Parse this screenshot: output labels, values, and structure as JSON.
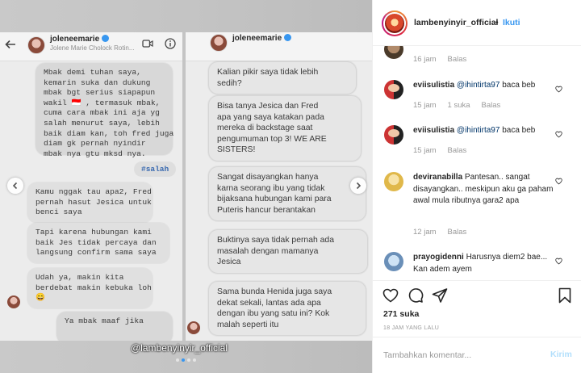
{
  "post": {
    "left_panel": {
      "username": "joleneemarie",
      "fullname": "Jolene Marie Cholock Rotin...",
      "bubbles": [
        "Mbak demi tuhan saya,\nkemarin suka dan dukung\nmbak bgt serius siapapun\nwakil 🇮🇩 , termasuk mbak,\ncuma cara mbak ini aja yg\nsalah menurut saya, lebih\nbaik diam kan, toh fred juga\ndiam gk pernah nyindir\nmbak nya gtu mksd nya.",
        "Kamu nggak tau apa2, Fred\npernah hasut Jesica untuk\nbenci saya",
        "Tapi karena hubungan kami\nbaik Jes tidak percaya dan\nlangsung confirm sama saya",
        "Udah ya, makin kita\nberdebat makin kebuka loh\n😄",
        "Ya mbak maaf jika"
      ],
      "tag": "#salah"
    },
    "right_panel": {
      "username": "joleneemarie",
      "bubbles": [
        "Kalian pikir saya tidak lebih\nsedih?",
        "Bisa tanya Jesica dan Fred\napa yang saya katakan pada\nmereka di backstage saat\npengumuman top 3! WE ARE\nSISTERS!",
        "Sangat disayangkan hanya\nkarna seorang ibu yang tidak\nbijaksana hubungan kami para\nPuteris hancur berantakan",
        "Buktinya saya tidak pernah ada\nmasalah dengan mamanya\nJesica",
        "Sama bunda Henida juga saya\ndekat sekali, lantas ada apa\ndengan ibu yang satu ini? Kok\nmalah seperti itu"
      ]
    },
    "watermark": "@lambenyinyir_official"
  },
  "sidebar": {
    "username": "lambenyinyir_official",
    "separator": "•",
    "follow_label": "Ikuti",
    "comments": [
      {
        "user": "",
        "mention": "",
        "text": "",
        "time": "16 jam",
        "likes": "",
        "reply": "Balas"
      },
      {
        "user": "eviisulistia",
        "mention": "@ihintirta97",
        "text": " baca beb",
        "time": "15 jam",
        "likes": "1 suka",
        "reply": "Balas"
      },
      {
        "user": "eviisulistia",
        "mention": "@ihintirta97",
        "text": " baca beb",
        "time": "15 jam",
        "likes": "",
        "reply": "Balas"
      },
      {
        "user": "deviranabilla",
        "mention": "",
        "text": " Pantesan.. sangat disayangkan.. meskipun aku ga paham awal mula ributnya gara2 apa",
        "time": "12 jam",
        "likes": "",
        "reply": "Balas"
      },
      {
        "user": "prayogidenni",
        "mention": "",
        "text": " Harusnya diem2 bae... Kan adem ayem",
        "time": "",
        "likes": "",
        "reply": ""
      }
    ],
    "likes": "271 suka",
    "time_ago": "18 JAM YANG LALU",
    "comment_placeholder": "Tambahkan komentar...",
    "post_label": "Kirim"
  }
}
